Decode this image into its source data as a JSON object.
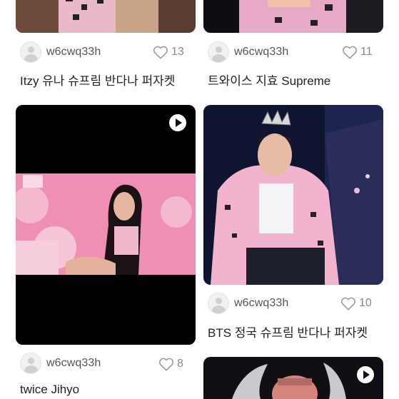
{
  "posts": [
    {
      "username": "w6cwq33h",
      "likes": "13",
      "title": "Itzy 유나 슈프림 반다나 퍼자켓"
    },
    {
      "username": "w6cwq33h",
      "likes": "11",
      "title": "트와이스 지효 Supreme"
    },
    {
      "username": "w6cwq33h",
      "likes": "8",
      "title": "twice Jihyo"
    },
    {
      "username": "w6cwq33h",
      "likes": "10",
      "title": "BTS 정국 슈프림 반다나 퍼자켓"
    },
    {
      "username": "",
      "likes": "",
      "title": ""
    }
  ],
  "icons": {
    "like": "heart-outline-icon",
    "play": "play-icon",
    "avatar": "default-avatar-icon"
  },
  "colors": {
    "text": "#222222",
    "muted": "#888888",
    "pink": "#f2a0c0"
  }
}
